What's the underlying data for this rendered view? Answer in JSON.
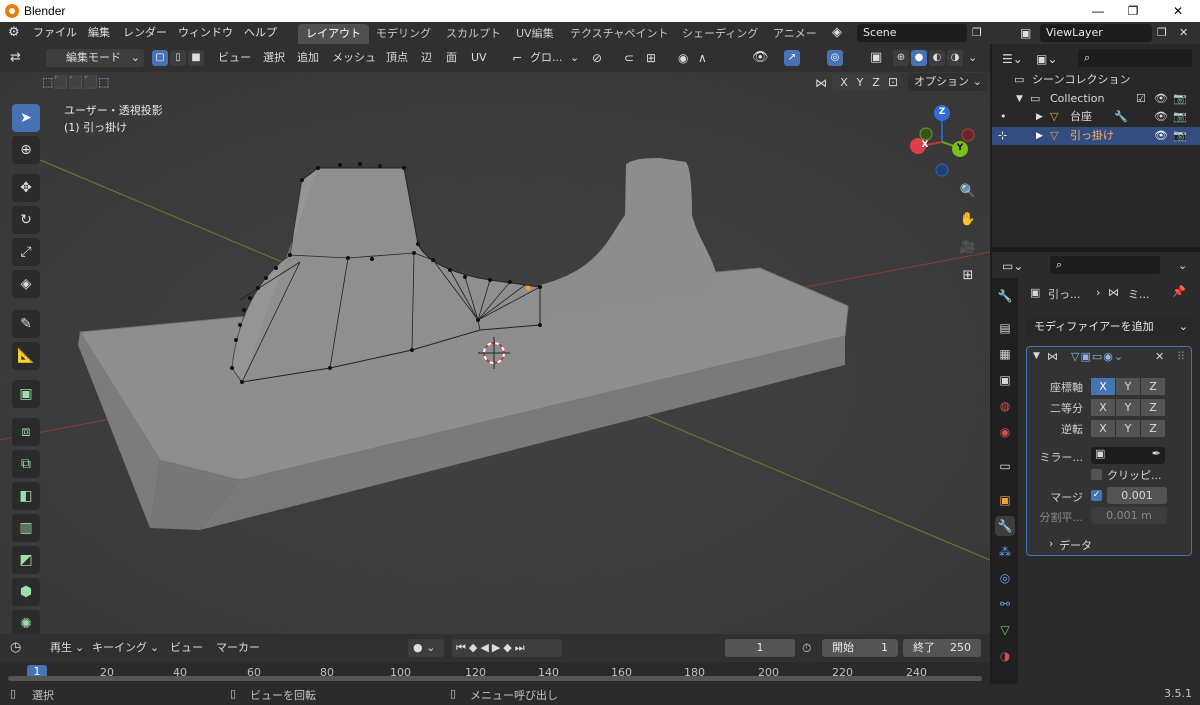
{
  "window": {
    "title": "Blender",
    "min": "—",
    "max": "❐",
    "close": "✕"
  },
  "menus": [
    "ファイル",
    "編集",
    "レンダー",
    "ウィンドウ",
    "ヘルプ"
  ],
  "workspaces": [
    "レイアウト",
    "モデリング",
    "スカルプト",
    "UV編集",
    "テクスチャペイント",
    "シェーディング",
    "アニメーシ"
  ],
  "scene": "Scene",
  "viewlayer": "ViewLayer",
  "vphead": {
    "mode": "編集モード",
    "menus": [
      "ビュー",
      "選択",
      "追加",
      "メッシュ",
      "頂点",
      "辺",
      "面",
      "UV"
    ],
    "orient": "グロ...",
    "options": "オプション"
  },
  "axes": [
    "X",
    "Y",
    "Z"
  ],
  "viewport": {
    "view": "ユーザー・透視投影",
    "object": "(1) 引っ掛け"
  },
  "gizmo": {
    "x": "X",
    "y": "Y",
    "z": "Z"
  },
  "timeline": {
    "play": "再生",
    "keying": "キーイング",
    "view": "ビュー",
    "marker": "マーカー",
    "current": "1",
    "start_label": "開始",
    "start": "1",
    "end_label": "終了",
    "end": "250",
    "ticks": [
      "1",
      "20",
      "40",
      "60",
      "80",
      "100",
      "120",
      "140",
      "160",
      "180",
      "200",
      "220",
      "240"
    ]
  },
  "status": {
    "select": "選択",
    "rotate": "ビューを回転",
    "menu": "メニュー呼び出し",
    "version": "3.5.1"
  },
  "outliner": {
    "scene_collection": "シーンコレクション",
    "collection": "Collection",
    "obj1": "台座",
    "obj2": "引っ掛け"
  },
  "props": {
    "crumb1": "引っ...",
    "crumb2": "ミ...",
    "add_modifier": "モディファイアーを追加",
    "axis": "座標軸",
    "bisect": "二等分",
    "flip": "逆転",
    "mirror": "ミラー...",
    "clip": "クリッピ...",
    "merge": "マージ",
    "merge_val": "0.001",
    "subdiv": "分割平...",
    "subdiv_val": "0.001 m",
    "data": "データ"
  }
}
